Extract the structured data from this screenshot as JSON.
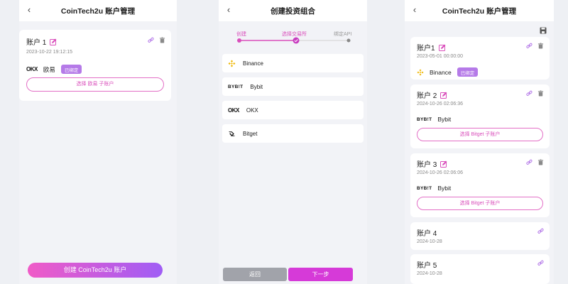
{
  "panel1": {
    "title": "CoinTech2u 账户管理",
    "account": {
      "name": "账户 1",
      "timestamp": "2023-10-22 19:12:15",
      "exchange_logo": "OKX",
      "exchange_name": "欧易",
      "badge": "已绑定",
      "select_button": "选择 欧易 子账户"
    },
    "create_button": "创建 CoinTech2u 账户"
  },
  "panel2": {
    "title": "创建投资组合",
    "steps": [
      "创建",
      "选择交易所",
      "绑定API"
    ],
    "current_step": 2,
    "exchanges": [
      {
        "icon": "binance-icon",
        "name": "Binance"
      },
      {
        "icon": "bybit-logo",
        "logo_text": "BYB!T",
        "name": "Bybit"
      },
      {
        "icon": "okx-logo",
        "logo_text": "OKX",
        "name": "OKX"
      },
      {
        "icon": "bitget-icon",
        "name": "Bitget"
      }
    ],
    "back_button": "返回",
    "next_button": "下一步"
  },
  "panel3": {
    "title": "CoinTech2u 账户管理",
    "accounts": [
      {
        "name": "账户1",
        "timestamp": "2023-05-01 00:00:00",
        "exchange_name": "Binance",
        "badge": "已绑定"
      },
      {
        "name": "账户 2",
        "timestamp": "2024-10-26 02:06:36",
        "logo_text": "BYB!T",
        "exchange_name": "Bybit",
        "select_button": "选择 Bitget 子账户"
      },
      {
        "name": "账户 3",
        "timestamp": "2024-10-26 02:06:06",
        "logo_text": "BYB!T",
        "exchange_name": "Bybit",
        "select_button": "选择 Bitget 子账户"
      },
      {
        "name": "账户 4",
        "timestamp": "2024-10-28"
      },
      {
        "name": "账户 5",
        "timestamp": "2024-10-28"
      }
    ]
  },
  "colors": {
    "accent": "#d94ebb",
    "badge": "#b57ae8",
    "gradient_start": "#f05bc7",
    "gradient_end": "#a05df5"
  }
}
